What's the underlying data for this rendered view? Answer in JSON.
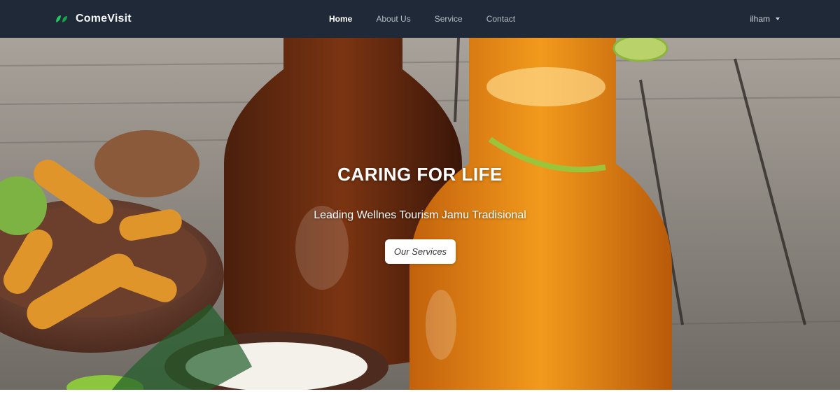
{
  "brand": {
    "name": "ComeVisit",
    "logo_icon": "leaf-logo-icon",
    "logo_color": "#22c55e"
  },
  "nav": {
    "items": [
      {
        "label": "Home",
        "active": true
      },
      {
        "label": "About Us",
        "active": false
      },
      {
        "label": "Service",
        "active": false
      },
      {
        "label": "Contact",
        "active": false
      }
    ]
  },
  "user": {
    "name": "ilham",
    "menu_icon": "caret-down-icon"
  },
  "hero": {
    "title": "CARING FOR LIFE",
    "subtitle": "Leading Wellnes Tourism Jamu Tradisional",
    "button_label": "Our Services"
  },
  "colors": {
    "navbar": "#1f2937",
    "hero_button": "#ffffff"
  }
}
